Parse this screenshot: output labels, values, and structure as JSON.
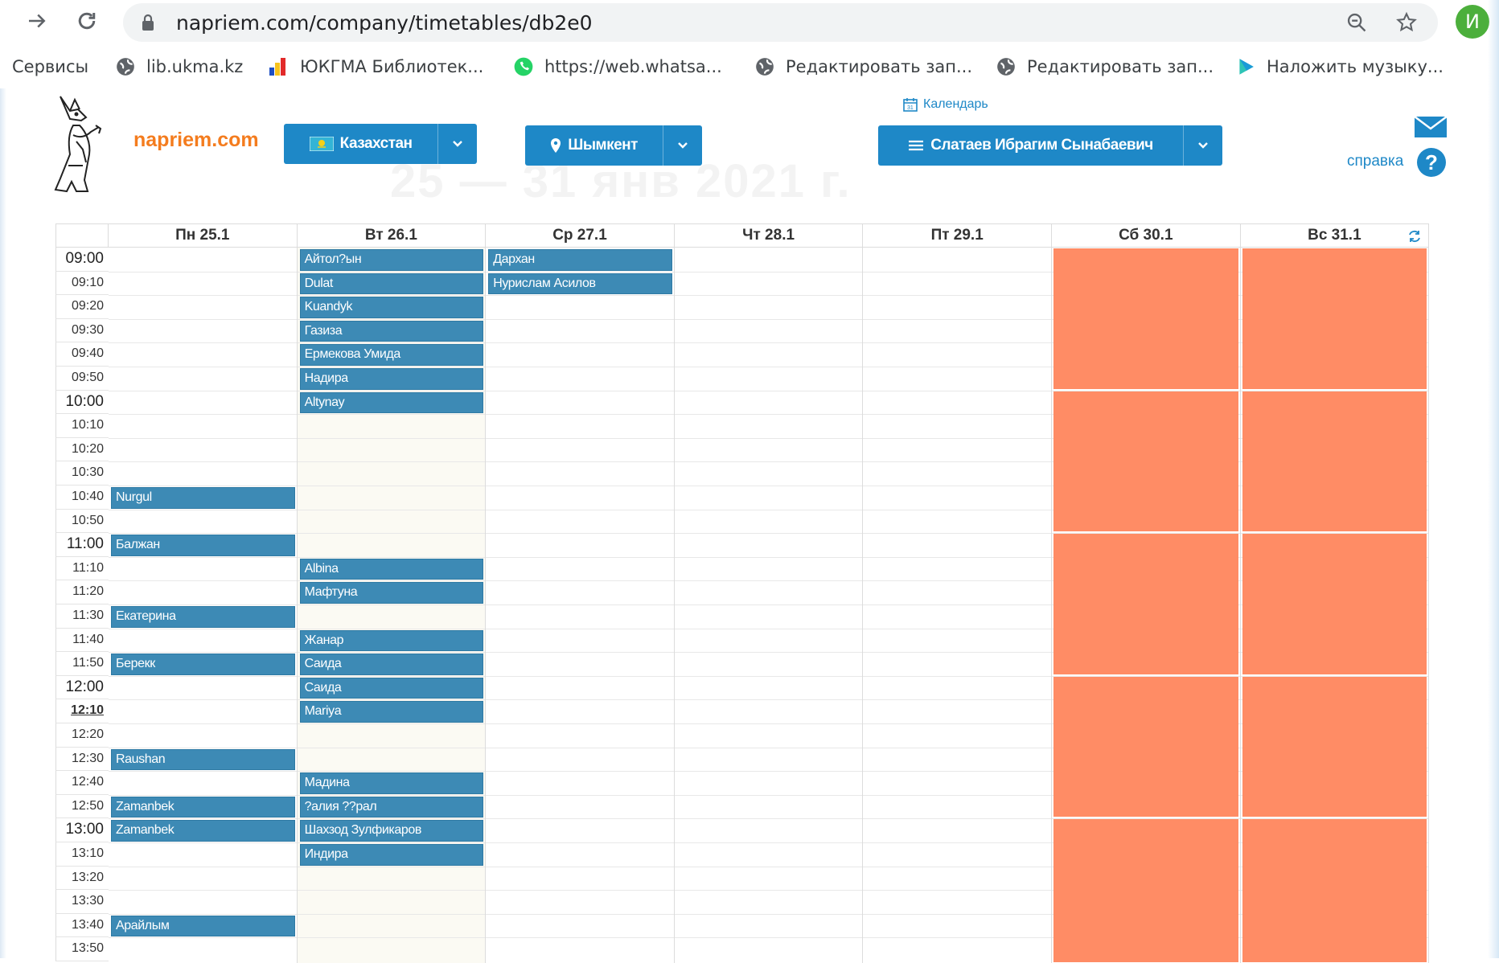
{
  "browser": {
    "url": "napriem.com/company/timetables/db2e0",
    "profile_initial": "И"
  },
  "bookmarks": [
    {
      "label": "Сервисы",
      "icon": "apps-icon"
    },
    {
      "label": "lib.ukma.kz",
      "icon": "globe-icon"
    },
    {
      "label": "ЮКГМА Библиотек...",
      "icon": "library-icon"
    },
    {
      "label": "https://web.whatsa...",
      "icon": "whatsapp-icon"
    },
    {
      "label": "Редактировать зап...",
      "icon": "globe-icon"
    },
    {
      "label": "Редактировать зап...",
      "icon": "globe-icon"
    },
    {
      "label": "Наложить музыку...",
      "icon": "play-icon"
    }
  ],
  "site": {
    "logo_text": "napriem.com",
    "ghost_title": "25 — 31 янв 2021 г.",
    "country": "Казахстан",
    "city": "Шымкент",
    "doctor": "Слатаев Ибрагим Сынабаевич",
    "calendar_link": "Календарь",
    "help_label": "справка"
  },
  "colors": {
    "accent": "#1e88c7",
    "appointment": "#3d8ab5",
    "weekend_closed": "#ff8c65",
    "logo": "#f47c1e"
  },
  "timetable": {
    "days": [
      "Пн 25.1",
      "Вт 26.1",
      "Ср 27.1",
      "Чт 28.1",
      "Пт 29.1",
      "Сб 30.1",
      "Вс 31.1"
    ],
    "times": [
      "09:00",
      "09:10",
      "09:20",
      "09:30",
      "09:40",
      "09:50",
      "10:00",
      "10:10",
      "10:20",
      "10:30",
      "10:40",
      "10:50",
      "11:00",
      "11:10",
      "11:20",
      "11:30",
      "11:40",
      "11:50",
      "12:00",
      "12:10",
      "12:20",
      "12:30",
      "12:40",
      "12:50",
      "13:00",
      "13:10",
      "13:20",
      "13:30",
      "13:40",
      "13:50"
    ],
    "current_time": "12:10",
    "appointments": [
      {
        "day": 0,
        "time": "10:40",
        "name": "Nurgul"
      },
      {
        "day": 0,
        "time": "11:00",
        "name": "Балжан"
      },
      {
        "day": 0,
        "time": "11:30",
        "name": "Екатерина"
      },
      {
        "day": 0,
        "time": "11:50",
        "name": "Берекк"
      },
      {
        "day": 0,
        "time": "12:30",
        "name": "Raushan"
      },
      {
        "day": 0,
        "time": "12:50",
        "name": "Zamanbek"
      },
      {
        "day": 0,
        "time": "13:00",
        "name": "Zamanbek"
      },
      {
        "day": 0,
        "time": "13:40",
        "name": "Арайлым"
      },
      {
        "day": 1,
        "time": "09:00",
        "name": "Айтол?ын"
      },
      {
        "day": 1,
        "time": "09:10",
        "name": "Dulat"
      },
      {
        "day": 1,
        "time": "09:20",
        "name": "Kuandyk"
      },
      {
        "day": 1,
        "time": "09:30",
        "name": "Газиза"
      },
      {
        "day": 1,
        "time": "09:40",
        "name": "Ермекова Умида"
      },
      {
        "day": 1,
        "time": "09:50",
        "name": "Надира"
      },
      {
        "day": 1,
        "time": "10:00",
        "name": "Altynay"
      },
      {
        "day": 1,
        "time": "11:10",
        "name": "Albina"
      },
      {
        "day": 1,
        "time": "11:20",
        "name": "Мафтуна"
      },
      {
        "day": 1,
        "time": "11:40",
        "name": "Жанар"
      },
      {
        "day": 1,
        "time": "11:50",
        "name": "Саида"
      },
      {
        "day": 1,
        "time": "12:00",
        "name": "Саида"
      },
      {
        "day": 1,
        "time": "12:10",
        "name": "Mariya"
      },
      {
        "day": 1,
        "time": "12:40",
        "name": "Мадина"
      },
      {
        "day": 1,
        "time": "12:50",
        "name": "?алия ??рал"
      },
      {
        "day": 1,
        "time": "13:00",
        "name": "Шахзод Зулфикаров"
      },
      {
        "day": 1,
        "time": "13:10",
        "name": "Индира"
      },
      {
        "day": 2,
        "time": "09:00",
        "name": "Дархан"
      },
      {
        "day": 2,
        "time": "09:10",
        "name": "Нурислам Асилов"
      }
    ],
    "closed_days": [
      5,
      6
    ]
  }
}
